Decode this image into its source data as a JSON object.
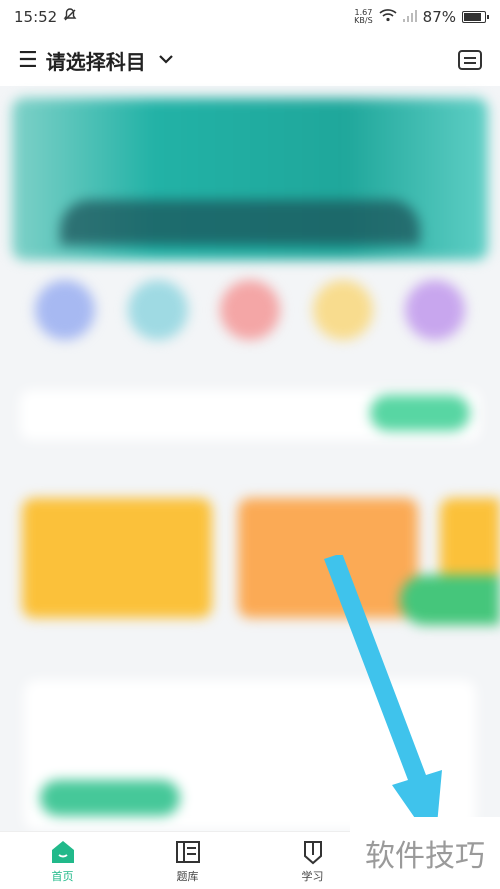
{
  "status": {
    "time": "15:52",
    "net_speed_value": "1.67",
    "net_speed_unit": "KB/S",
    "battery": "87%"
  },
  "header": {
    "title": "请选择科目"
  },
  "tabs": [
    {
      "label": "首页",
      "icon": "home-icon",
      "active": true
    },
    {
      "label": "题库",
      "icon": "book-icon",
      "active": false
    },
    {
      "label": "学习",
      "icon": "pencil-icon",
      "active": false
    }
  ],
  "watermark": "软件技巧",
  "colors": {
    "accent": "#21b98a",
    "arrow": "#3fc3ec",
    "banner": "#22b2a6"
  }
}
